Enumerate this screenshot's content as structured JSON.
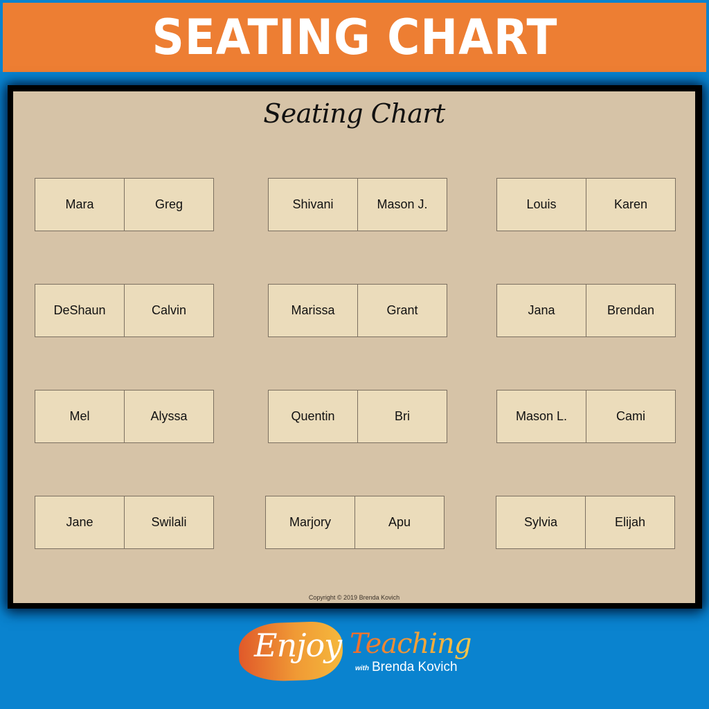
{
  "banner": {
    "title": "SEATING CHART"
  },
  "board": {
    "title": "Seating Chart",
    "copyright": "Copyright © 2019 Brenda Kovich",
    "rows": [
      [
        [
          "Mara",
          "Greg"
        ],
        [
          "Shivani",
          "Mason J."
        ],
        [
          "Louis",
          "Karen"
        ]
      ],
      [
        [
          "DeShaun",
          "Calvin"
        ],
        [
          "Marissa",
          "Grant"
        ],
        [
          "Jana",
          "Brendan"
        ]
      ],
      [
        [
          "Mel",
          "Alyssa"
        ],
        [
          "Quentin",
          "Bri"
        ],
        [
          "Mason L.",
          "Cami"
        ]
      ],
      [
        [
          "Jane",
          "Swilali"
        ],
        [
          "Marjory",
          "Apu"
        ],
        [
          "Sylvia",
          "Elijah"
        ]
      ]
    ]
  },
  "logo": {
    "enjoy": "Enjoy",
    "teaching": "Teaching",
    "with": "with",
    "author": "Brenda Kovich"
  },
  "colors": {
    "background_blue": "#0a83cf",
    "banner_orange": "#ed7e33",
    "board_tan": "#d6c3a7",
    "desk_cream": "#ebdcbb"
  }
}
